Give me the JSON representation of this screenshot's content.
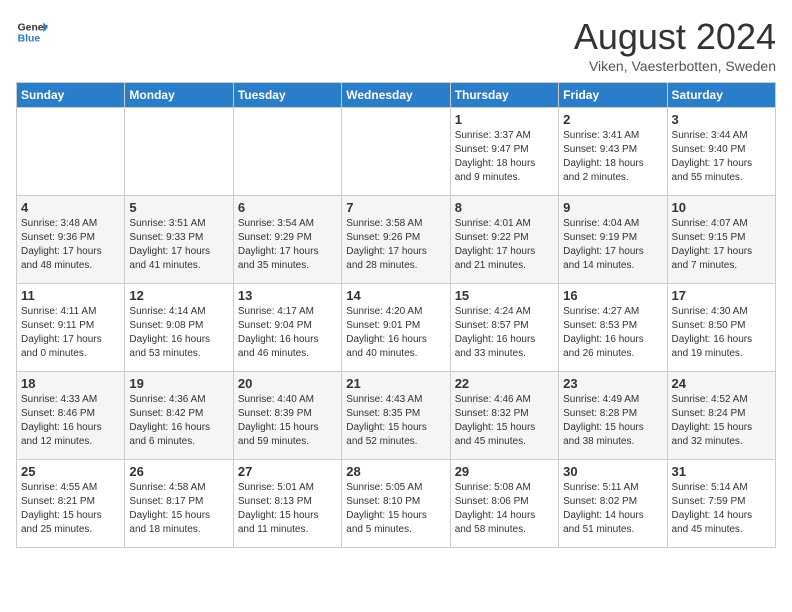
{
  "header": {
    "logo_line1": "General",
    "logo_line2": "Blue",
    "month": "August 2024",
    "location": "Viken, Vaesterbotten, Sweden"
  },
  "days_of_week": [
    "Sunday",
    "Monday",
    "Tuesday",
    "Wednesday",
    "Thursday",
    "Friday",
    "Saturday"
  ],
  "weeks": [
    [
      {
        "day": "",
        "text": ""
      },
      {
        "day": "",
        "text": ""
      },
      {
        "day": "",
        "text": ""
      },
      {
        "day": "",
        "text": ""
      },
      {
        "day": "1",
        "text": "Sunrise: 3:37 AM\nSunset: 9:47 PM\nDaylight: 18 hours\nand 9 minutes."
      },
      {
        "day": "2",
        "text": "Sunrise: 3:41 AM\nSunset: 9:43 PM\nDaylight: 18 hours\nand 2 minutes."
      },
      {
        "day": "3",
        "text": "Sunrise: 3:44 AM\nSunset: 9:40 PM\nDaylight: 17 hours\nand 55 minutes."
      }
    ],
    [
      {
        "day": "4",
        "text": "Sunrise: 3:48 AM\nSunset: 9:36 PM\nDaylight: 17 hours\nand 48 minutes."
      },
      {
        "day": "5",
        "text": "Sunrise: 3:51 AM\nSunset: 9:33 PM\nDaylight: 17 hours\nand 41 minutes."
      },
      {
        "day": "6",
        "text": "Sunrise: 3:54 AM\nSunset: 9:29 PM\nDaylight: 17 hours\nand 35 minutes."
      },
      {
        "day": "7",
        "text": "Sunrise: 3:58 AM\nSunset: 9:26 PM\nDaylight: 17 hours\nand 28 minutes."
      },
      {
        "day": "8",
        "text": "Sunrise: 4:01 AM\nSunset: 9:22 PM\nDaylight: 17 hours\nand 21 minutes."
      },
      {
        "day": "9",
        "text": "Sunrise: 4:04 AM\nSunset: 9:19 PM\nDaylight: 17 hours\nand 14 minutes."
      },
      {
        "day": "10",
        "text": "Sunrise: 4:07 AM\nSunset: 9:15 PM\nDaylight: 17 hours\nand 7 minutes."
      }
    ],
    [
      {
        "day": "11",
        "text": "Sunrise: 4:11 AM\nSunset: 9:11 PM\nDaylight: 17 hours\nand 0 minutes."
      },
      {
        "day": "12",
        "text": "Sunrise: 4:14 AM\nSunset: 9:08 PM\nDaylight: 16 hours\nand 53 minutes."
      },
      {
        "day": "13",
        "text": "Sunrise: 4:17 AM\nSunset: 9:04 PM\nDaylight: 16 hours\nand 46 minutes."
      },
      {
        "day": "14",
        "text": "Sunrise: 4:20 AM\nSunset: 9:01 PM\nDaylight: 16 hours\nand 40 minutes."
      },
      {
        "day": "15",
        "text": "Sunrise: 4:24 AM\nSunset: 8:57 PM\nDaylight: 16 hours\nand 33 minutes."
      },
      {
        "day": "16",
        "text": "Sunrise: 4:27 AM\nSunset: 8:53 PM\nDaylight: 16 hours\nand 26 minutes."
      },
      {
        "day": "17",
        "text": "Sunrise: 4:30 AM\nSunset: 8:50 PM\nDaylight: 16 hours\nand 19 minutes."
      }
    ],
    [
      {
        "day": "18",
        "text": "Sunrise: 4:33 AM\nSunset: 8:46 PM\nDaylight: 16 hours\nand 12 minutes."
      },
      {
        "day": "19",
        "text": "Sunrise: 4:36 AM\nSunset: 8:42 PM\nDaylight: 16 hours\nand 6 minutes."
      },
      {
        "day": "20",
        "text": "Sunrise: 4:40 AM\nSunset: 8:39 PM\nDaylight: 15 hours\nand 59 minutes."
      },
      {
        "day": "21",
        "text": "Sunrise: 4:43 AM\nSunset: 8:35 PM\nDaylight: 15 hours\nand 52 minutes."
      },
      {
        "day": "22",
        "text": "Sunrise: 4:46 AM\nSunset: 8:32 PM\nDaylight: 15 hours\nand 45 minutes."
      },
      {
        "day": "23",
        "text": "Sunrise: 4:49 AM\nSunset: 8:28 PM\nDaylight: 15 hours\nand 38 minutes."
      },
      {
        "day": "24",
        "text": "Sunrise: 4:52 AM\nSunset: 8:24 PM\nDaylight: 15 hours\nand 32 minutes."
      }
    ],
    [
      {
        "day": "25",
        "text": "Sunrise: 4:55 AM\nSunset: 8:21 PM\nDaylight: 15 hours\nand 25 minutes."
      },
      {
        "day": "26",
        "text": "Sunrise: 4:58 AM\nSunset: 8:17 PM\nDaylight: 15 hours\nand 18 minutes."
      },
      {
        "day": "27",
        "text": "Sunrise: 5:01 AM\nSunset: 8:13 PM\nDaylight: 15 hours\nand 11 minutes."
      },
      {
        "day": "28",
        "text": "Sunrise: 5:05 AM\nSunset: 8:10 PM\nDaylight: 15 hours\nand 5 minutes."
      },
      {
        "day": "29",
        "text": "Sunrise: 5:08 AM\nSunset: 8:06 PM\nDaylight: 14 hours\nand 58 minutes."
      },
      {
        "day": "30",
        "text": "Sunrise: 5:11 AM\nSunset: 8:02 PM\nDaylight: 14 hours\nand 51 minutes."
      },
      {
        "day": "31",
        "text": "Sunrise: 5:14 AM\nSunset: 7:59 PM\nDaylight: 14 hours\nand 45 minutes."
      }
    ]
  ]
}
